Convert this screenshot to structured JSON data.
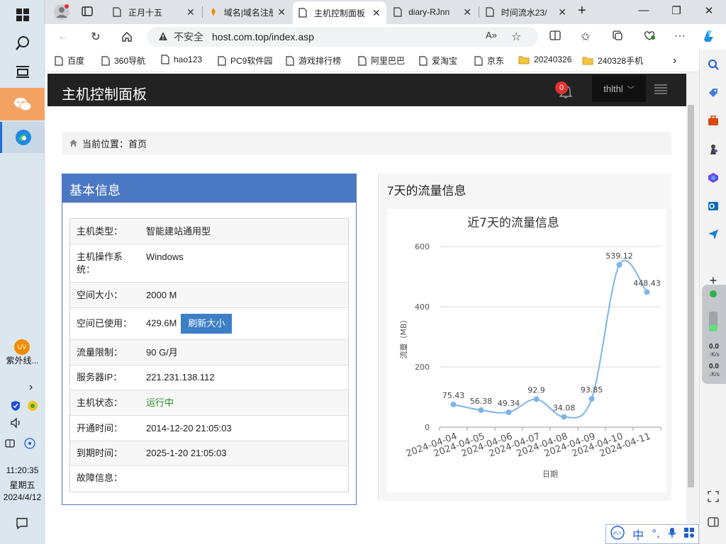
{
  "taskbar": {
    "uv_label": "UV",
    "uv_app": "紫外线...",
    "chevron": "›",
    "clock_time": "11:20:35",
    "clock_weekday": "星期五",
    "clock_date": "2024/4/12"
  },
  "tabs": [
    {
      "title": "正月十五",
      "icon": "document-icon"
    },
    {
      "title": "域名|域名注册",
      "icon": "orange-logo-icon"
    },
    {
      "title": "主机控制面板",
      "icon": "document-icon",
      "active": true
    },
    {
      "title": "diary-RJnn",
      "icon": "document-icon"
    },
    {
      "title": "时间流水23/",
      "icon": "document-icon"
    }
  ],
  "tab_close": "✕",
  "new_tab": "+",
  "address": {
    "insecure_label": "不安全",
    "url": "host.com.top/index.asp"
  },
  "bookmarks": [
    {
      "label": "百度",
      "icon": "document-icon"
    },
    {
      "label": "360导航",
      "icon": "document-icon"
    },
    {
      "label": "hao123",
      "icon": "document-icon"
    },
    {
      "label": "PC9软件园",
      "icon": "document-icon"
    },
    {
      "label": "游戏排行榜",
      "icon": "document-icon"
    },
    {
      "label": "阿里巴巴",
      "icon": "document-icon"
    },
    {
      "label": "爱淘宝",
      "icon": "document-icon"
    },
    {
      "label": "京东",
      "icon": "document-icon"
    },
    {
      "label": "20240326",
      "icon": "folder-icon"
    },
    {
      "label": "240328手机",
      "icon": "folder-icon"
    }
  ],
  "net_widget": {
    "up": "0.0",
    "up_unit": "K/s",
    "down": "0.0",
    "down_unit": "K/s"
  },
  "header": {
    "brand": "主机控制面板",
    "notification_count": "0",
    "username": "thlthl"
  },
  "breadcrumb": {
    "label": "当前位置：",
    "current": "首页"
  },
  "basic_info": {
    "title": "基本信息",
    "refresh_label": "刷新大小",
    "rows": [
      {
        "key": "主机类型：",
        "value": "智能建站通用型"
      },
      {
        "key": "主机操作系统：",
        "value": "Windows"
      },
      {
        "key": "空间大小：",
        "value": "2000 M"
      },
      {
        "key": "空间已使用：",
        "value": "429.6M"
      },
      {
        "key": "流量限制：",
        "value": "90 G/月"
      },
      {
        "key": "服务器IP：",
        "value": "221.231.138.112"
      },
      {
        "key": "主机状态：",
        "value": "运行中"
      },
      {
        "key": "开通时间：",
        "value": "2014-12-20 21:05:03"
      },
      {
        "key": "到期时间：",
        "value": "2025-1-20 21:05:03"
      },
      {
        "key": "故障信息：",
        "value": ""
      }
    ]
  },
  "traffic": {
    "title": "7天的流量信息"
  },
  "chart_data": {
    "type": "line",
    "title": "近7天的流量信息",
    "xlabel": "日期",
    "ylabel": "流量（MB）",
    "categories": [
      "2024-04-04",
      "2024-04-05",
      "2024-04-06",
      "2024-04-07",
      "2024-04-08",
      "2024-04-09",
      "2024-04-10",
      "2024-04-11"
    ],
    "values": [
      75.43,
      56.38,
      49.34,
      92.9,
      34.08,
      93.85,
      539.12,
      448.43
    ],
    "ylim": [
      0,
      600
    ],
    "yticks": [
      "0",
      "200",
      "400",
      "600"
    ],
    "line_color": "#7cb5ec",
    "grid": true,
    "smooth": true
  },
  "ime": {
    "chinese": "中"
  }
}
